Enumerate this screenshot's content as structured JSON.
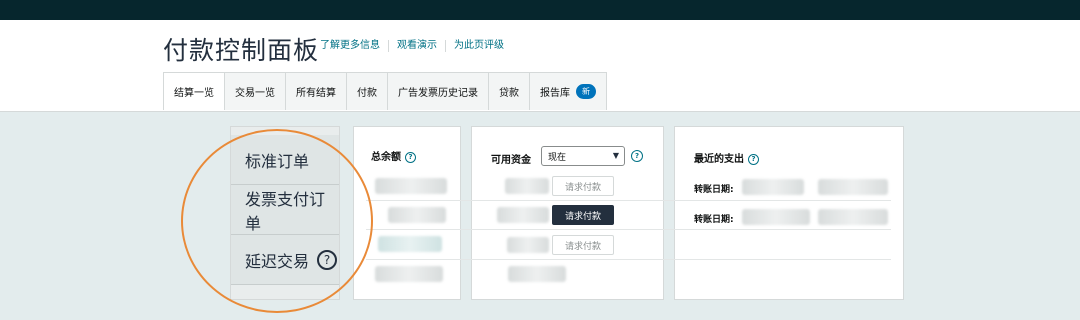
{
  "page": {
    "title": "付款控制面板",
    "links": [
      "了解更多信息",
      "观看演示",
      "为此页评级"
    ]
  },
  "tabs": [
    {
      "label": "结算一览"
    },
    {
      "label": "交易一览"
    },
    {
      "label": "所有结算"
    },
    {
      "label": "付款"
    },
    {
      "label": "广告发票历史记录"
    },
    {
      "label": "贷款"
    },
    {
      "label": "报告库",
      "badge": "新"
    }
  ],
  "menu": {
    "items": [
      "标准订单",
      "发票支付订单",
      "延迟交易"
    ],
    "help_symbol": "?"
  },
  "balance": {
    "title": "总余额"
  },
  "funds": {
    "title": "可用资金",
    "select_value": "现在",
    "buttons": [
      "请求付款",
      "请求付款",
      "请求付款"
    ]
  },
  "recent": {
    "title": "最近的支出",
    "rows": [
      {
        "label": "转账日期:"
      },
      {
        "label": "转账日期:"
      }
    ]
  },
  "colors": {
    "topbar": "#06262d",
    "accent_circle": "#e98a38",
    "link": "#007185",
    "badge": "#0073bb",
    "dark_button": "#232f3e"
  }
}
